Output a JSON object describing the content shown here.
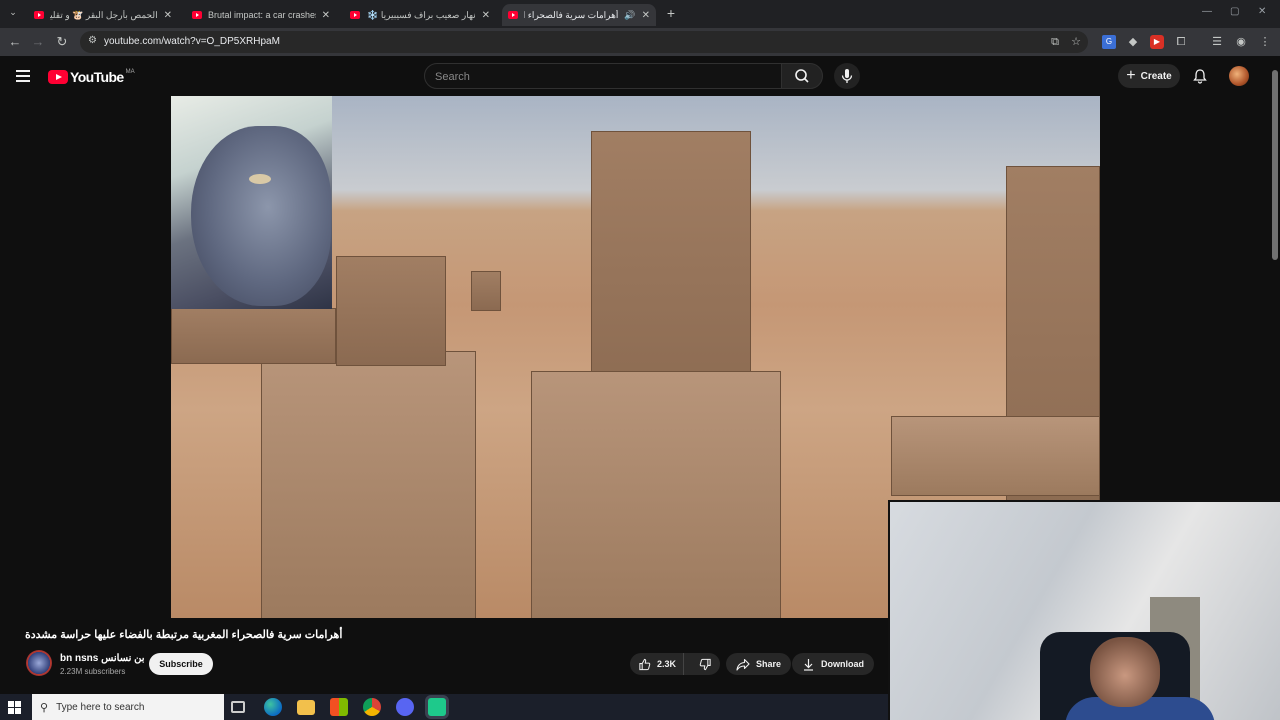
{
  "browser": {
    "tabs": [
      {
        "title": "الحمص بأرجل البقر 🐮 و تقليم أ...",
        "active": false
      },
      {
        "title": "Brutal impact: a car crashes",
        "active": false
      },
      {
        "title": "نهار صعيب براف فسيبيريا ❄️ جلـ",
        "active": false
      },
      {
        "title": "أهرامات سرية فالصحراء المغ",
        "active": true
      }
    ],
    "url": "youtube.com/watch?v=O_DP5XRHpaM"
  },
  "youtube": {
    "logo_text": "YouTube",
    "country_code": "MA",
    "search_placeholder": "Search",
    "create_label": "Create"
  },
  "video": {
    "title": "أهرامات سرية فالصحراء المغربية مرتبطة بالفضاء عليها حراسة مشددة",
    "channel_name": "bn nsns بن نسانس",
    "subscribers": "2.23M subscribers",
    "subscribe_label": "Subscribe",
    "likes": "2.3K",
    "share_label": "Share",
    "download_label": "Download"
  },
  "taskbar": {
    "search_placeholder": "Type here to search"
  },
  "colors": {
    "youtube_red": "#ff0033",
    "page_bg": "#0f0f0f"
  }
}
